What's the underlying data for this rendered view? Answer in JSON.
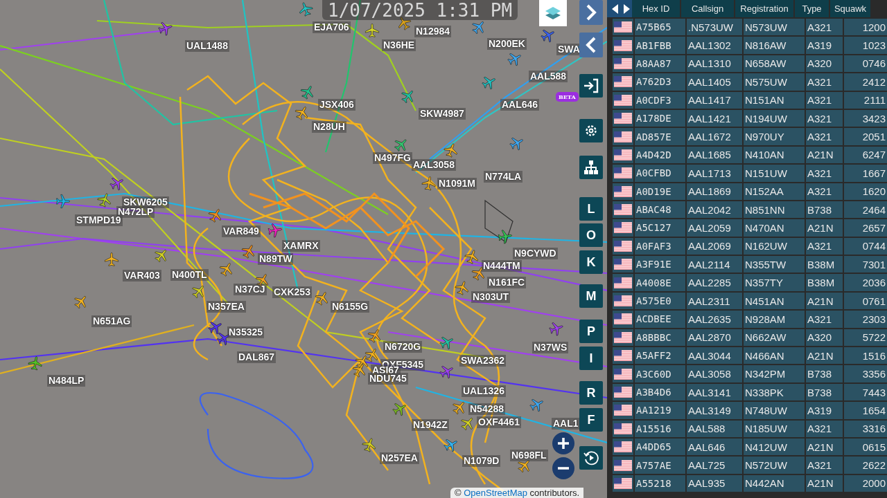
{
  "map": {
    "timestamp": "1/07/2025 1:31 PM",
    "aircraft": [
      {
        "callsign": "EJA706",
        "color": "#22c4c4"
      },
      {
        "callsign": "N12984",
        "color": "#d9a21b"
      },
      {
        "callsign": "N36HE",
        "color": "#d6d62a"
      },
      {
        "callsign": "N200EK",
        "color": "#3fa9f2"
      },
      {
        "callsign": "SWA",
        "color": "#3a62f0"
      },
      {
        "callsign": "UAL1488",
        "color": "#a042f0"
      },
      {
        "callsign": "AAL588",
        "color": "#3fa9f2"
      },
      {
        "callsign": "AAL646",
        "color": "#22c4c4"
      },
      {
        "callsign": "JSX406",
        "color": "#22c48e"
      },
      {
        "callsign": "SKW4987",
        "color": "#22c4a4"
      },
      {
        "callsign": "N28UH",
        "color": "#f2b21f"
      },
      {
        "callsign": "N497FG",
        "color": "#33c46e"
      },
      {
        "callsign": "AAL3058",
        "color": "#f2b21f"
      },
      {
        "callsign": "N1091M",
        "color": "#f2b21f"
      },
      {
        "callsign": "N774LA",
        "color": "#3fa9f2"
      },
      {
        "callsign": "SKW6205",
        "color": "#a042f0"
      },
      {
        "callsign": "N472LP",
        "color": "#b2d224"
      },
      {
        "callsign": "STMPD19",
        "color": "#22b4e4"
      },
      {
        "callsign": "VAR849",
        "color": "#f2921f"
      },
      {
        "callsign": "XAMRX",
        "color": "#f222c2"
      },
      {
        "callsign": "N89TW",
        "color": "#f2921f"
      },
      {
        "callsign": "VAR403",
        "color": "#f2b21f"
      },
      {
        "callsign": "N400TL",
        "color": "#d2d224"
      },
      {
        "callsign": "N37CJ",
        "color": "#f2b21f"
      },
      {
        "callsign": "CXK253",
        "color": "#f2a21f"
      },
      {
        "callsign": "N357EA",
        "color": "#d2d224"
      },
      {
        "callsign": "N651AG",
        "color": "#f2b21f"
      },
      {
        "callsign": "N35325",
        "color": "#5232f2"
      },
      {
        "callsign": "DAL867",
        "color": "#5232f2"
      },
      {
        "callsign": "N484LP",
        "color": "#52c424"
      },
      {
        "callsign": "N9CYWD",
        "color": "#33c452"
      },
      {
        "callsign": "N444TM",
        "color": "#f2b21f"
      },
      {
        "callsign": "N161FC",
        "color": "#f2a21f"
      },
      {
        "callsign": "N303UT",
        "color": "#f2b21f"
      },
      {
        "callsign": "N6155G",
        "color": "#f2b21f"
      },
      {
        "callsign": "N6720G",
        "color": "#f2a21f"
      },
      {
        "callsign": "N37WS",
        "color": "#a042f0"
      },
      {
        "callsign": "SWA2362",
        "color": "#22c4a4"
      },
      {
        "callsign": "OXF5345",
        "color": "#f2b21f"
      },
      {
        "callsign": "ASI67",
        "color": "#f2b21f"
      },
      {
        "callsign": "NDU745",
        "color": "#f2b21f"
      },
      {
        "callsign": "UAL1326",
        "color": "#a042f0"
      },
      {
        "callsign": "N54288",
        "color": "#f2b21f"
      },
      {
        "callsign": "OXF4461",
        "color": "#d2d224"
      },
      {
        "callsign": "N1942Z",
        "color": "#82c424"
      },
      {
        "callsign": "N257EA",
        "color": "#d2d224"
      },
      {
        "callsign": "N1079D",
        "color": "#33b4f2"
      },
      {
        "callsign": "N698FL",
        "color": "#f2b21f"
      },
      {
        "callsign": "AAL1",
        "color": "#3fa9f2"
      }
    ],
    "filter_buttons": [
      "L",
      "O",
      "K",
      "M",
      "P",
      "I",
      "R",
      "F"
    ],
    "badge": "BETA",
    "attribution": {
      "prefix": "©",
      "link": "OpenStreetMap",
      "suffix": "contributors."
    }
  },
  "table": {
    "columns": [
      "Hex ID",
      "Callsign",
      "Registration",
      "Type",
      "Squawk"
    ],
    "rows": [
      [
        "A75B65",
        ".N573UW",
        "N573UW",
        "A321",
        "1200"
      ],
      [
        "AB1FBB",
        "AAL1302",
        "N816AW",
        "A319",
        "1023"
      ],
      [
        "A8AA87",
        "AAL1310",
        "N658AW",
        "A320",
        "0746"
      ],
      [
        "A762D3",
        "AAL1405",
        "N575UW",
        "A321",
        "2412"
      ],
      [
        "A0CDF3",
        "AAL1417",
        "N151AN",
        "A321",
        "2111"
      ],
      [
        "A178DE",
        "AAL1421",
        "N194UW",
        "A321",
        "3423"
      ],
      [
        "AD857E",
        "AAL1672",
        "N970UY",
        "A321",
        "2051"
      ],
      [
        "A4D42D",
        "AAL1685",
        "N410AN",
        "A21N",
        "6247"
      ],
      [
        "A0CFBD",
        "AAL1713",
        "N151UW",
        "A321",
        "1667"
      ],
      [
        "A0D19E",
        "AAL1869",
        "N152AA",
        "A321",
        "1620"
      ],
      [
        "ABAC48",
        "AAL2042",
        "N851NN",
        "B738",
        "2464"
      ],
      [
        "A5C127",
        "AAL2059",
        "N470AN",
        "A21N",
        "2657"
      ],
      [
        "A0FAF3",
        "AAL2069",
        "N162UW",
        "A321",
        "0744"
      ],
      [
        "A3F91E",
        "AAL2114",
        "N355TW",
        "B38M",
        "7301"
      ],
      [
        "A4008E",
        "AAL2285",
        "N357TY",
        "B38M",
        "2036"
      ],
      [
        "A575E0",
        "AAL2311",
        "N451AN",
        "A21N",
        "0761"
      ],
      [
        "ACDBEE",
        "AAL2635",
        "N928AM",
        "A321",
        "2303"
      ],
      [
        "A8BBBC",
        "AAL2870",
        "N662AW",
        "A320",
        "5722"
      ],
      [
        "A5AFF2",
        "AAL3044",
        "N466AN",
        "A21N",
        "1516"
      ],
      [
        "A3C60D",
        "AAL3058",
        "N342PM",
        "B738",
        "3356"
      ],
      [
        "A3B4D6",
        "AAL3141",
        "N338PK",
        "B738",
        "7443"
      ],
      [
        "AA1219",
        "AAL3149",
        "N748UW",
        "A319",
        "1654"
      ],
      [
        "A15516",
        "AAL588",
        "N185UW",
        "A321",
        "3316"
      ],
      [
        "A4DD65",
        "AAL646",
        "N412UW",
        "A21N",
        "0615"
      ],
      [
        "A757AE",
        "AAL725",
        "N572UW",
        "A321",
        "2622"
      ],
      [
        "A55218",
        "AAL935",
        "N442AN",
        "A21N",
        "2000"
      ]
    ]
  }
}
